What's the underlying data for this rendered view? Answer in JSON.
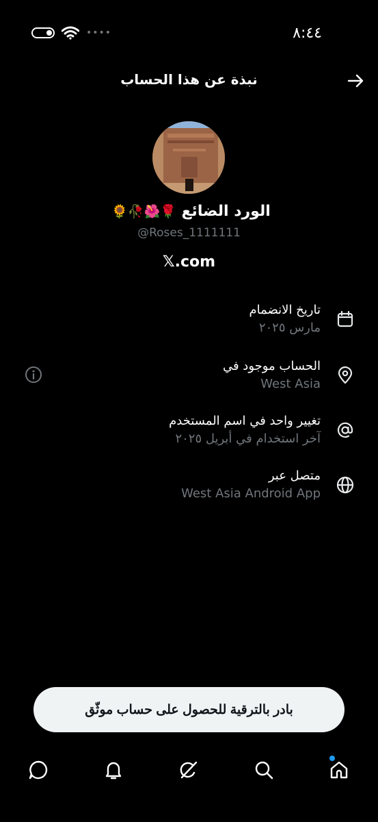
{
  "status_bar": {
    "time": "٨:٤٤",
    "signal_dots": "••••"
  },
  "header": {
    "title": "نبذة عن هذا الحساب"
  },
  "profile": {
    "name": "الورد الضائع",
    "emojis": "🌹🌺🥀🌻",
    "handle": "@Roses_1111111",
    "x_link": "𝕏.com"
  },
  "info": [
    {
      "icon": "calendar-icon",
      "title": "تاريخ الانضمام",
      "subtitle": "مارس ٢٠٢٥"
    },
    {
      "icon": "location-pin-icon",
      "title": "الحساب موجود في",
      "subtitle": "West Asia"
    },
    {
      "icon": "at-sign-icon",
      "title": "تغيير واحد في اسم المستخدم",
      "subtitle": "آخر استخدام في أبريل ٢٠٢٥"
    },
    {
      "icon": "globe-icon",
      "title": "متصل عبر",
      "subtitle": "West Asia Android App"
    }
  ],
  "upgrade": {
    "label": "بادر بالترقية للحصول على حساب موثّق"
  },
  "nav": [
    "home-icon",
    "search-icon",
    "grok-icon",
    "notifications-icon",
    "messages-icon"
  ],
  "colors": {
    "background": "#000000",
    "text_primary": "#e7e9ea",
    "text_secondary": "#71767b",
    "accent": "#1d9bf0"
  }
}
